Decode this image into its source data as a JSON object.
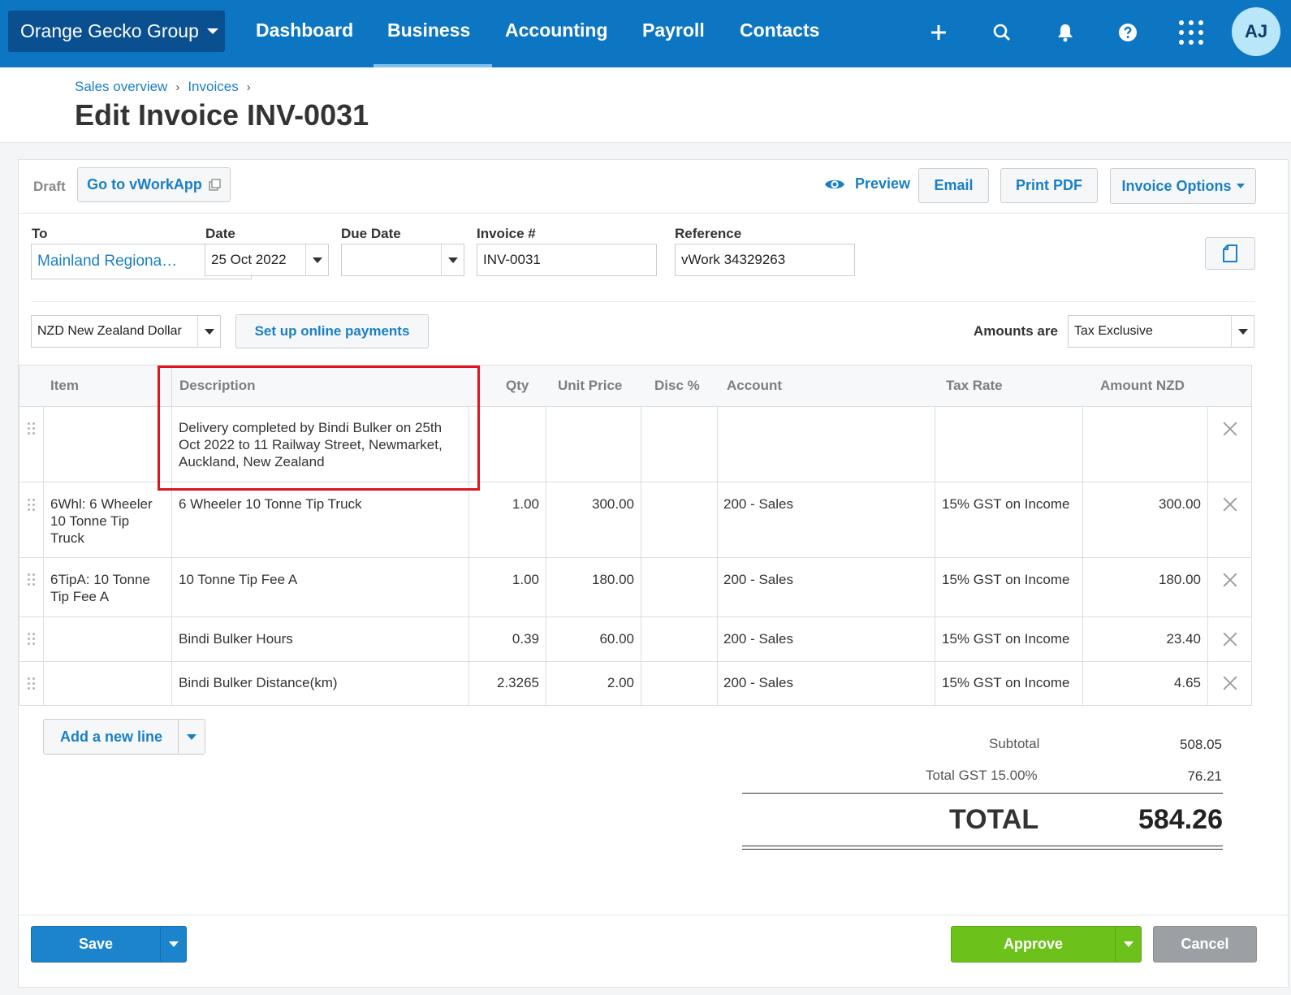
{
  "nav": {
    "org_name": "Orange Gecko Group",
    "items": [
      "Dashboard",
      "Business",
      "Accounting",
      "Payroll",
      "Contacts"
    ],
    "active_item": "Business",
    "avatar_initials": "AJ"
  },
  "breadcrumb": [
    "Sales overview",
    "Invoices"
  ],
  "page_title": "Edit Invoice INV-0031",
  "toolbar": {
    "status": "Draft",
    "vworkapp_label": "Go to vWorkApp",
    "preview_label": "Preview",
    "email_label": "Email",
    "print_pdf_label": "Print PDF",
    "invoice_options_label": "Invoice Options"
  },
  "fields": {
    "to_label": "To",
    "to_value": "Mainland Regiona…",
    "date_label": "Date",
    "date_value": "25 Oct 2022",
    "due_date_label": "Due Date",
    "due_date_value": "",
    "invoice_number_label": "Invoice #",
    "invoice_number_value": "INV-0031",
    "reference_label": "Reference",
    "reference_value": "vWork 34329263"
  },
  "currency": {
    "value": "NZD New Zealand Dollar",
    "online_payments_label": "Set up online payments",
    "amounts_are_label": "Amounts are",
    "amounts_are_value": "Tax Exclusive"
  },
  "table": {
    "headers": {
      "item": "Item",
      "description": "Description",
      "qty": "Qty",
      "unit_price": "Unit Price",
      "disc": "Disc %",
      "account": "Account",
      "tax_rate": "Tax Rate",
      "amount": "Amount NZD"
    },
    "rows": [
      {
        "item": "",
        "description": "Delivery completed by Bindi Bulker on 25th Oct 2022 to 11 Railway Street, Newmarket, Auckland, New Zealand",
        "qty": "",
        "unit_price": "",
        "disc": "",
        "account": "",
        "tax_rate": "",
        "amount": ""
      },
      {
        "item": "6Whl: 6 Wheeler 10 Tonne Tip Truck",
        "description": "6 Wheeler 10 Tonne Tip Truck",
        "qty": "1.00",
        "unit_price": "300.00",
        "disc": "",
        "account": "200 - Sales",
        "tax_rate": "15% GST on Income",
        "amount": "300.00"
      },
      {
        "item": "6TipA: 10 Tonne Tip Fee A",
        "description": "10 Tonne Tip Fee A",
        "qty": "1.00",
        "unit_price": "180.00",
        "disc": "",
        "account": "200 - Sales",
        "tax_rate": "15% GST on Income",
        "amount": "180.00"
      },
      {
        "item": "",
        "description": "Bindi Bulker Hours",
        "qty": "0.39",
        "unit_price": "60.00",
        "disc": "",
        "account": "200 - Sales",
        "tax_rate": "15% GST on Income",
        "amount": "23.40"
      },
      {
        "item": "",
        "description": "Bindi Bulker Distance(km)",
        "qty": "2.3265",
        "unit_price": "2.00",
        "disc": "",
        "account": "200 - Sales",
        "tax_rate": "15% GST on Income",
        "amount": "4.65"
      }
    ]
  },
  "add_line_label": "Add a new line",
  "totals": {
    "subtotal_label": "Subtotal",
    "subtotal_value": "508.05",
    "gst_label": "Total GST 15.00%",
    "gst_value": "76.21",
    "total_label": "TOTAL",
    "total_value": "584.26"
  },
  "footer": {
    "save_label": "Save",
    "approve_label": "Approve",
    "cancel_label": "Cancel"
  },
  "colors": {
    "nav_bg": "#0d76c2",
    "link": "#1a7fc4",
    "approve": "#6cc11b",
    "save": "#1b84cc",
    "highlight": "#e0141e"
  }
}
